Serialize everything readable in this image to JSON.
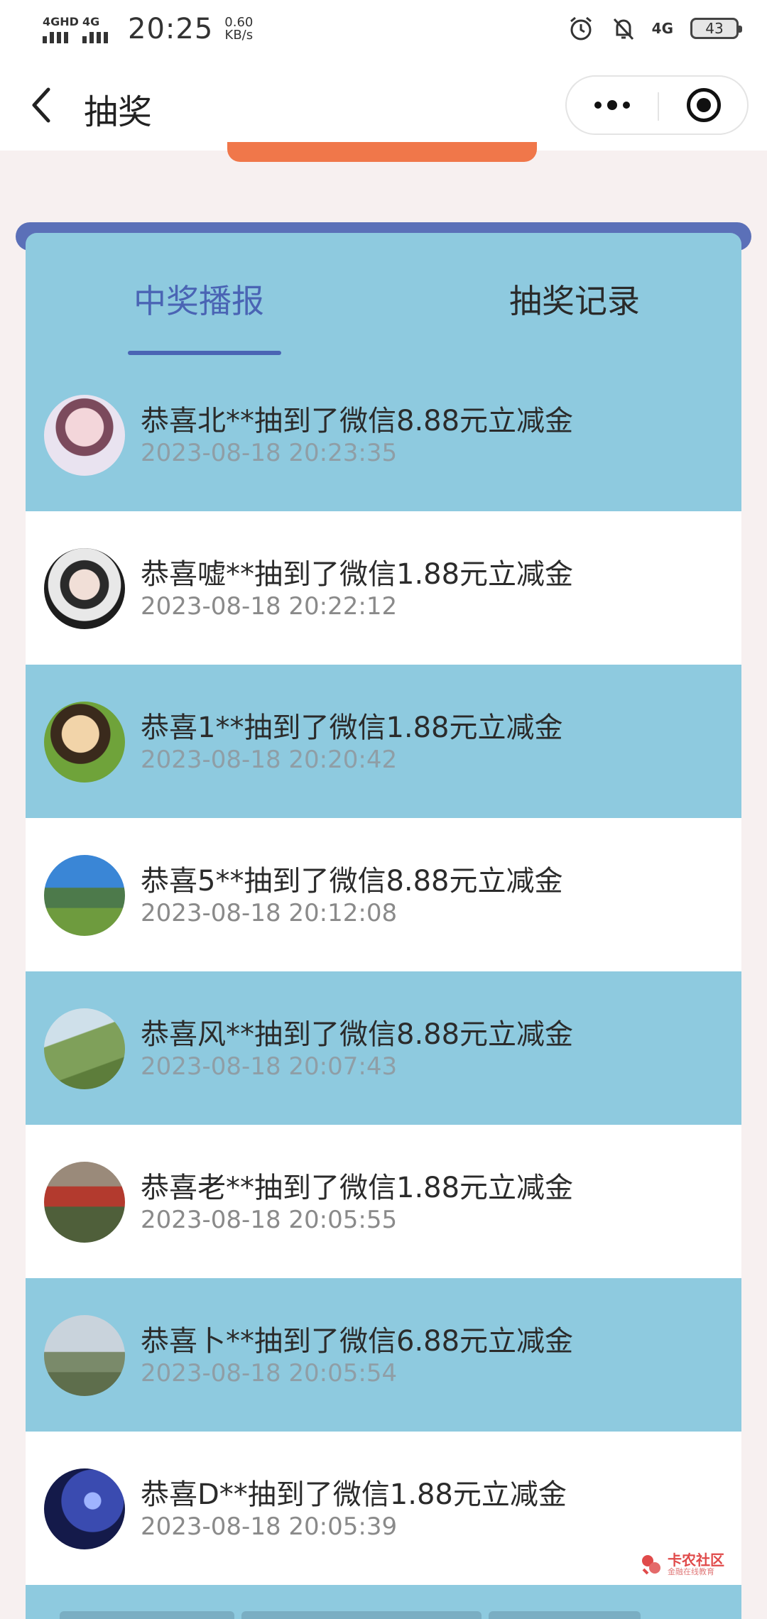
{
  "status_bar": {
    "signal1_label": "4GHD",
    "signal2_label": "4G",
    "time": "20:25",
    "speed_value": "0.60",
    "speed_unit": "KB/s",
    "network": "4G",
    "battery": "43"
  },
  "navbar": {
    "title": "抽奖"
  },
  "tabs": [
    {
      "label": "中奖播报"
    },
    {
      "label": "抽奖记录"
    }
  ],
  "winners": [
    {
      "message": "恭喜北**抽到了微信8.88元立减金",
      "time": "2023-08-18 20:23:35"
    },
    {
      "message": "恭喜嘘**抽到了微信1.88元立减金",
      "time": "2023-08-18 20:22:12"
    },
    {
      "message": "恭喜1**抽到了微信1.88元立减金",
      "time": "2023-08-18 20:20:42"
    },
    {
      "message": "恭喜5**抽到了微信8.88元立减金",
      "time": "2023-08-18 20:12:08"
    },
    {
      "message": "恭喜风**抽到了微信8.88元立减金",
      "time": "2023-08-18 20:07:43"
    },
    {
      "message": "恭喜老**抽到了微信1.88元立减金",
      "time": "2023-08-18 20:05:55"
    },
    {
      "message": "恭喜卜**抽到了微信6.88元立减金",
      "time": "2023-08-18 20:05:54"
    },
    {
      "message": "恭喜D**抽到了微信1.88元立减金",
      "time": "2023-08-18 20:05:39"
    }
  ],
  "watermark": {
    "main": "卡农社区",
    "sub": "金融在线教育"
  },
  "colors": {
    "accent": "#4a64b4",
    "card_blue": "#8ecadf",
    "frame": "#5b70b8",
    "orange": "#f0774a"
  }
}
